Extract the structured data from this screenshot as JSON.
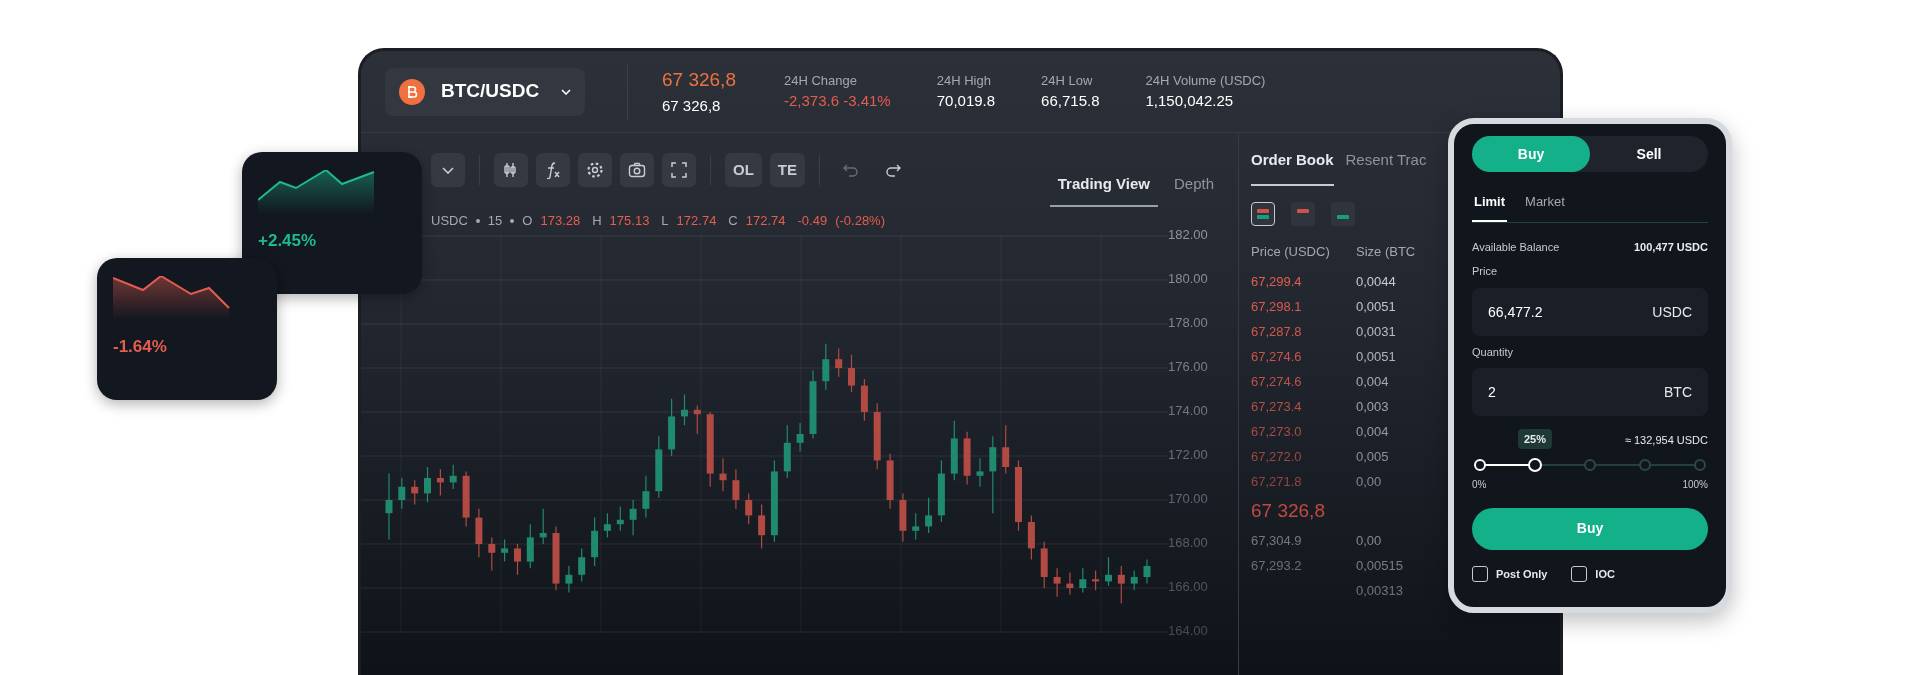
{
  "header": {
    "pair": "BTC/USDC",
    "last_price": "67 326,8",
    "mark_price": "67 326,8",
    "stats": [
      {
        "label": "24H Change",
        "value": "-2,373.6 -3.41%",
        "kind": "negative"
      },
      {
        "label": "24H High",
        "value": "70,019.8",
        "kind": "neutral"
      },
      {
        "label": "24H Low",
        "value": "66,715.8",
        "kind": "neutral"
      },
      {
        "label": "24H Volume (USDC)",
        "value": "1,150,042.25",
        "kind": "neutral"
      }
    ]
  },
  "toolbar": {
    "tools": [
      {
        "kind": "dropdown",
        "disabled": false
      },
      {
        "kind": "candles",
        "disabled": false
      },
      {
        "kind": "function",
        "disabled": false
      },
      {
        "kind": "settings",
        "disabled": false
      },
      {
        "kind": "camera",
        "disabled": false
      },
      {
        "kind": "fullscreen",
        "disabled": false
      },
      {
        "kind": "text",
        "label": "OL",
        "disabled": false
      },
      {
        "kind": "text",
        "label": "TE",
        "disabled": false
      },
      {
        "kind": "undo",
        "disabled": true
      },
      {
        "kind": "redo",
        "disabled": false
      }
    ]
  },
  "view_tabs": [
    {
      "label": "Trading View",
      "selected": true
    },
    {
      "label": "Depth",
      "selected": false
    }
  ],
  "legend": {
    "symbol": "USDC",
    "interval": "15",
    "ohlc": [
      {
        "label": "O",
        "value": "173.28"
      },
      {
        "label": "H",
        "value": "175.13"
      },
      {
        "label": "L",
        "value": "172.74"
      },
      {
        "label": "C",
        "value": "172.74"
      }
    ],
    "change": "-0.49",
    "change_pct": "(-0.28%)"
  },
  "chart_data": {
    "type": "candlestick",
    "grid": true,
    "ylim": [
      164,
      182
    ],
    "ohlc": [
      [
        169.4,
        171.2,
        168.2,
        170.0
      ],
      [
        170.0,
        171.0,
        169.6,
        170.6
      ],
      [
        170.6,
        170.9,
        169.8,
        170.3
      ],
      [
        170.3,
        171.5,
        169.9,
        171.0
      ],
      [
        171.0,
        171.4,
        170.2,
        170.8
      ],
      [
        170.8,
        171.6,
        170.5,
        171.1
      ],
      [
        171.1,
        171.3,
        168.8,
        169.2
      ],
      [
        169.2,
        169.6,
        167.4,
        168.0
      ],
      [
        168.0,
        168.3,
        166.8,
        167.6
      ],
      [
        167.6,
        168.2,
        167.2,
        167.8
      ],
      [
        167.8,
        168.0,
        166.6,
        167.2
      ],
      [
        167.2,
        168.9,
        166.9,
        168.3
      ],
      [
        168.3,
        169.6,
        168.0,
        168.5
      ],
      [
        168.5,
        168.8,
        165.9,
        166.2
      ],
      [
        166.2,
        167.0,
        165.8,
        166.6
      ],
      [
        166.6,
        167.8,
        166.3,
        167.4
      ],
      [
        167.4,
        169.2,
        167.0,
        168.6
      ],
      [
        168.6,
        169.4,
        168.3,
        168.9
      ],
      [
        168.9,
        169.7,
        168.6,
        169.1
      ],
      [
        169.1,
        170.0,
        168.4,
        169.6
      ],
      [
        169.6,
        171.1,
        169.2,
        170.4
      ],
      [
        170.4,
        172.9,
        170.1,
        172.3
      ],
      [
        172.3,
        174.6,
        172.0,
        173.8
      ],
      [
        173.8,
        174.8,
        173.4,
        174.1
      ],
      [
        174.1,
        174.3,
        173.0,
        173.9
      ],
      [
        173.9,
        174.0,
        170.6,
        171.2
      ],
      [
        171.2,
        171.9,
        170.4,
        170.9
      ],
      [
        170.9,
        171.4,
        169.6,
        170.0
      ],
      [
        170.0,
        170.3,
        168.9,
        169.3
      ],
      [
        169.3,
        169.8,
        167.8,
        168.4
      ],
      [
        168.4,
        171.8,
        168.1,
        171.3
      ],
      [
        171.3,
        173.4,
        171.0,
        172.6
      ],
      [
        172.6,
        173.5,
        172.2,
        173.0
      ],
      [
        173.0,
        175.9,
        172.8,
        175.4
      ],
      [
        175.4,
        177.1,
        175.0,
        176.4
      ],
      [
        176.4,
        176.9,
        175.6,
        176.0
      ],
      [
        176.0,
        176.6,
        174.9,
        175.2
      ],
      [
        175.2,
        175.5,
        173.6,
        174.0
      ],
      [
        174.0,
        174.4,
        171.4,
        171.8
      ],
      [
        171.8,
        172.1,
        169.6,
        170.0
      ],
      [
        170.0,
        170.3,
        168.1,
        168.6
      ],
      [
        168.6,
        169.4,
        168.2,
        168.8
      ],
      [
        168.8,
        170.1,
        168.5,
        169.3
      ],
      [
        169.3,
        171.8,
        169.0,
        171.2
      ],
      [
        171.2,
        173.6,
        170.9,
        172.8
      ],
      [
        172.8,
        173.1,
        170.7,
        171.1
      ],
      [
        171.1,
        171.9,
        170.6,
        171.3
      ],
      [
        171.3,
        172.9,
        169.4,
        172.4
      ],
      [
        172.4,
        173.4,
        171.2,
        171.5
      ],
      [
        171.5,
        171.8,
        168.6,
        169.0
      ],
      [
        169.0,
        169.3,
        167.3,
        167.8
      ],
      [
        167.8,
        168.1,
        166.0,
        166.5
      ],
      [
        166.5,
        166.9,
        165.6,
        166.2
      ],
      [
        166.2,
        166.7,
        165.7,
        166.0
      ],
      [
        166.0,
        166.9,
        165.8,
        166.4
      ],
      [
        166.4,
        166.8,
        165.9,
        166.3
      ],
      [
        166.3,
        167.4,
        166.1,
        166.6
      ],
      [
        166.6,
        167.0,
        165.3,
        166.2
      ],
      [
        166.2,
        166.8,
        165.9,
        166.5
      ],
      [
        166.5,
        167.3,
        166.2,
        167.0
      ]
    ],
    "yticks": [
      {
        "value": 182,
        "label": "182.00"
      },
      {
        "value": 180,
        "label": "180.00"
      },
      {
        "value": 178,
        "label": "178.00"
      },
      {
        "value": 176,
        "label": "176.00"
      },
      {
        "value": 174,
        "label": "174.00"
      },
      {
        "value": 172,
        "label": "172.00"
      },
      {
        "value": 170,
        "label": "170.00"
      },
      {
        "value": 168,
        "label": "168.00"
      },
      {
        "value": 166,
        "label": "166.00"
      },
      {
        "value": 164,
        "label": "164.00"
      }
    ]
  },
  "order_book": {
    "tabs": [
      {
        "label": "Order Book",
        "selected": true
      },
      {
        "label": "Resent Trac",
        "selected": false
      }
    ],
    "modes": [
      {
        "kind": "both",
        "selected": true
      },
      {
        "kind": "asks",
        "selected": false
      },
      {
        "kind": "bids",
        "selected": false
      }
    ],
    "columns": [
      "Price (USDC)",
      "Size (BTC"
    ],
    "asks": [
      {
        "price": "67,299.4",
        "size": "0,0044"
      },
      {
        "price": "67,298.1",
        "size": "0,0051"
      },
      {
        "price": "67,287.8",
        "size": "0,0031"
      },
      {
        "price": "67,274.6",
        "size": "0,0051"
      },
      {
        "price": "67,274.6",
        "size": "0,004"
      },
      {
        "price": "67,273.4",
        "size": "0,003"
      },
      {
        "price": "67,273.0",
        "size": "0,004"
      },
      {
        "price": "67,272.0",
        "size": "0,005"
      },
      {
        "price": "67,271.8",
        "size": "0,00"
      }
    ],
    "mid_price": "67 326,8",
    "bids": [
      {
        "price": "67,304.9",
        "size": "0,00"
      },
      {
        "price": "67,293.2",
        "size": "0,00515"
      },
      {
        "size": "0,00313"
      }
    ]
  },
  "trade_panel": {
    "sides": [
      {
        "label": "Buy",
        "selected": true
      },
      {
        "label": "Sell",
        "selected": false
      }
    ],
    "order_types": [
      {
        "label": "Limit",
        "selected": true
      },
      {
        "label": "Market",
        "selected": false
      }
    ],
    "balance_label": "Available Balance",
    "balance": "100,477 USDC",
    "price_label": "Price",
    "price_value": "66,477.2",
    "price_unit": "USDC",
    "quantity_label": "Quantity",
    "quantity_value": "2",
    "quantity_unit": "BTC",
    "estimate": "≈ 132,954 USDC",
    "slider": {
      "level": 0.25,
      "tooltip": "25%",
      "min_label": "0%",
      "max_label": "100%"
    },
    "submit": "Buy",
    "options": [
      {
        "label": "Post Only",
        "checked": false
      },
      {
        "label": "IOC",
        "checked": false
      }
    ]
  },
  "mini_cards": [
    {
      "value": "+2.45%",
      "kind": "gain"
    },
    {
      "value": "-1.64%",
      "kind": "loss"
    }
  ]
}
